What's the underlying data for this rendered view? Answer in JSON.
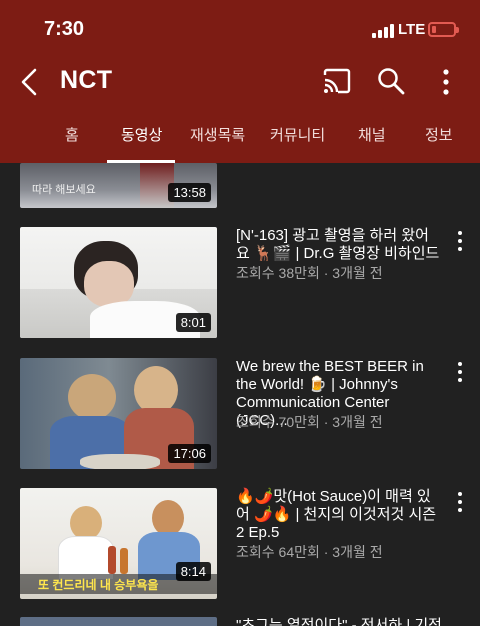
{
  "status_bar": {
    "time": "7:30",
    "network": "LTE"
  },
  "app_bar": {
    "title": "NCT"
  },
  "tabs": [
    {
      "label": "홈"
    },
    {
      "label": "동영상",
      "active": true
    },
    {
      "label": "재생목록"
    },
    {
      "label": "커뮤니티"
    },
    {
      "label": "채널"
    },
    {
      "label": "정보"
    }
  ],
  "videos": [
    {
      "thumb_caption": "따라 해보세요",
      "duration": "13:58"
    },
    {
      "title": "[N'-163] 광고 촬영을 하러 왔어요 🦌🎬 | Dr.G 촬영장 비하인드",
      "meta": "조회수 38만회 · 3개월 전",
      "duration": "8:01"
    },
    {
      "title": "We brew the BEST BEER in the World! 🍺 | Johnny's Communication Center (JCC)...",
      "meta": "조회수 70만회 · 3개월 전",
      "duration": "17:06"
    },
    {
      "title": "🔥🌶️맛(Hot Sauce)이 매력 있어 🌶️🔥 | 천지의 이것저것 시즌2 Ep.5",
      "meta": "조회수 64만회 · 3개월 전",
      "duration": "8:14",
      "thumb_caption": "또 컨드리네 내 승부욕을"
    },
    {
      "title": "\"초그는 열정이다\" - 전서하 | 기정오"
    }
  ],
  "colors": {
    "header_bg": "#7d1c14",
    "body_bg": "#212121",
    "meta_text": "#aaaaaa"
  }
}
